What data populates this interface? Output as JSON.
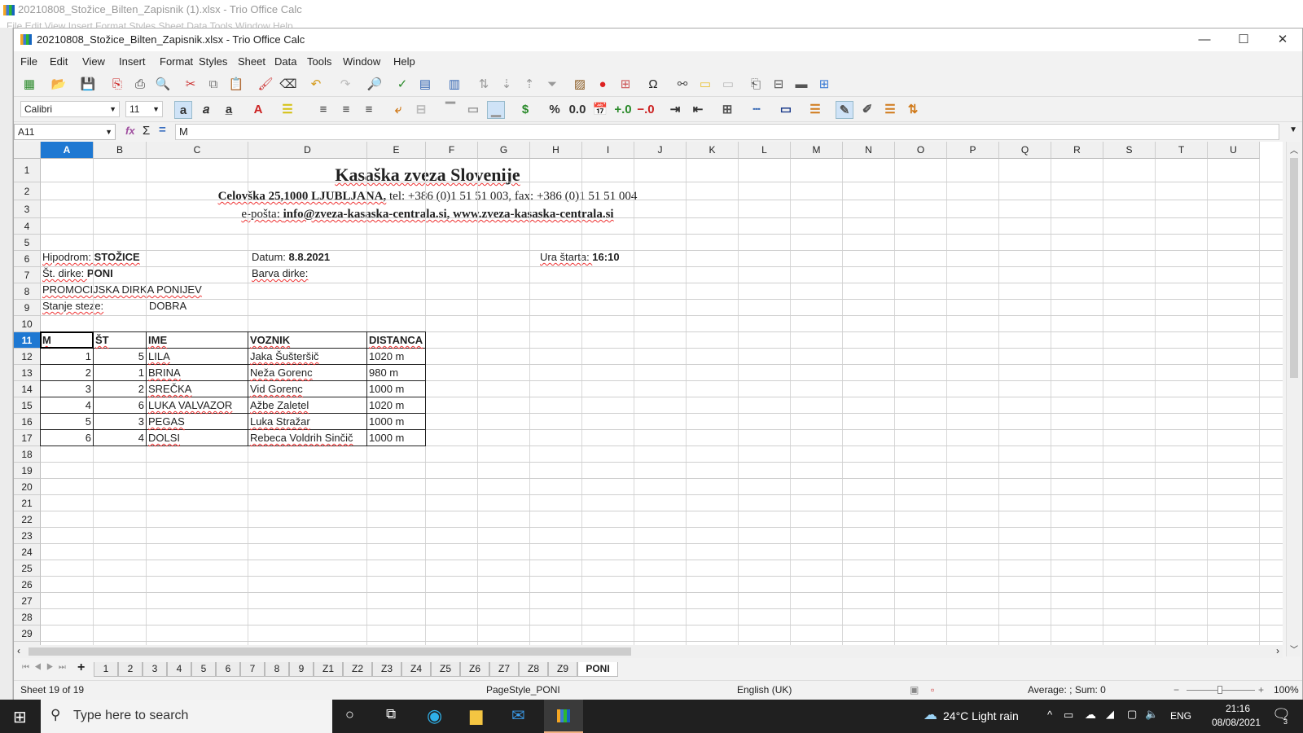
{
  "background_window": {
    "title": "20210808_Stožice_Bilten_Zapisnik (1).xlsx - Trio Office Calc",
    "menu_ghost": "File  Edit  View  Insert  Format  Styles  Sheet  Data  Tools  Window  Help"
  },
  "window": {
    "title": "20210808_Stožice_Bilten_Zapisnik.xlsx - Trio Office Calc",
    "minimize": "—",
    "maximize": "☐",
    "close": "✕"
  },
  "menu": [
    "File",
    "Edit",
    "View",
    "Insert",
    "Format",
    "Styles",
    "Sheet",
    "Data",
    "Tools",
    "Window",
    "Help"
  ],
  "formatting": {
    "font_name": "Calibri",
    "font_size": "11"
  },
  "formula_bar": {
    "name_box": "A11",
    "content": "M"
  },
  "columns": [
    "A",
    "B",
    "C",
    "D",
    "E",
    "F",
    "G",
    "H",
    "I",
    "J",
    "K",
    "L",
    "M",
    "N",
    "O",
    "P",
    "Q",
    "R",
    "S",
    "T",
    "U"
  ],
  "active_column": "A",
  "active_row": 11,
  "header": {
    "title": "Kasaška zveza Slovenije",
    "address_bold": "Celovška 25,1000 LJUBLJANA,",
    "address_rest": " tel: +386 (0)1 51 51 003, fax: +386 (0)1 51 51 004",
    "email_label": "e-pošta: ",
    "email_value": "info@zveza-kasaska-centrala.si, www.zveza-kasaska-centrala.si"
  },
  "info": {
    "hipodrom_label": "Hipodrom: ",
    "hipodrom_value": "STOŽICE",
    "datum_label": "Datum: ",
    "datum_value": "8.8.2021",
    "ura_label": "Ura štarta: ",
    "ura_value": "16:10",
    "st_dirke_label": "Št. dirke: ",
    "st_dirke_value": "PONI",
    "barva_label": "Barva dirke:",
    "race_name": "PROMOCIJSKA DIRKA PONIJEV",
    "stanje_label": "Stanje steze:",
    "stanje_value": "DOBRA"
  },
  "table": {
    "headers": [
      "M",
      "ŠT",
      "IME",
      "VOZNIK",
      "DISTANCA"
    ],
    "rows": [
      [
        "1",
        "5",
        "LILA",
        "Jaka Šušteršič",
        "1020 m"
      ],
      [
        "2",
        "1",
        "BRINA",
        "Neža Gorenc",
        "980 m"
      ],
      [
        "3",
        "2",
        "SREČKA",
        "Vid Gorenc",
        "1000 m"
      ],
      [
        "4",
        "6",
        "LUKA VALVAZOR",
        "Ažbe Zaletel",
        "1020 m"
      ],
      [
        "5",
        "3",
        "PEGAS",
        "Luka Stražar",
        "1000 m"
      ],
      [
        "6",
        "4",
        "DOLSI",
        "Rebeca Voldrih Sinčič",
        "1000 m"
      ]
    ]
  },
  "sheet_tabs": [
    "1",
    "2",
    "3",
    "4",
    "5",
    "6",
    "7",
    "8",
    "9",
    "Z1",
    "Z2",
    "Z3",
    "Z4",
    "Z5",
    "Z6",
    "Z7",
    "Z8",
    "Z9",
    "PONI"
  ],
  "active_sheet": "PONI",
  "status": {
    "sheet": "Sheet 19 of 19",
    "page_style": "PageStyle_PONI",
    "language": "English (UK)",
    "summary": "Average: ; Sum: 0",
    "zoom": "100%"
  },
  "taskbar": {
    "search_placeholder": "Type here to search",
    "weather": "24°C  Light rain",
    "language": "ENG",
    "time": "21:16",
    "date": "08/08/2021",
    "notifications": "3"
  }
}
